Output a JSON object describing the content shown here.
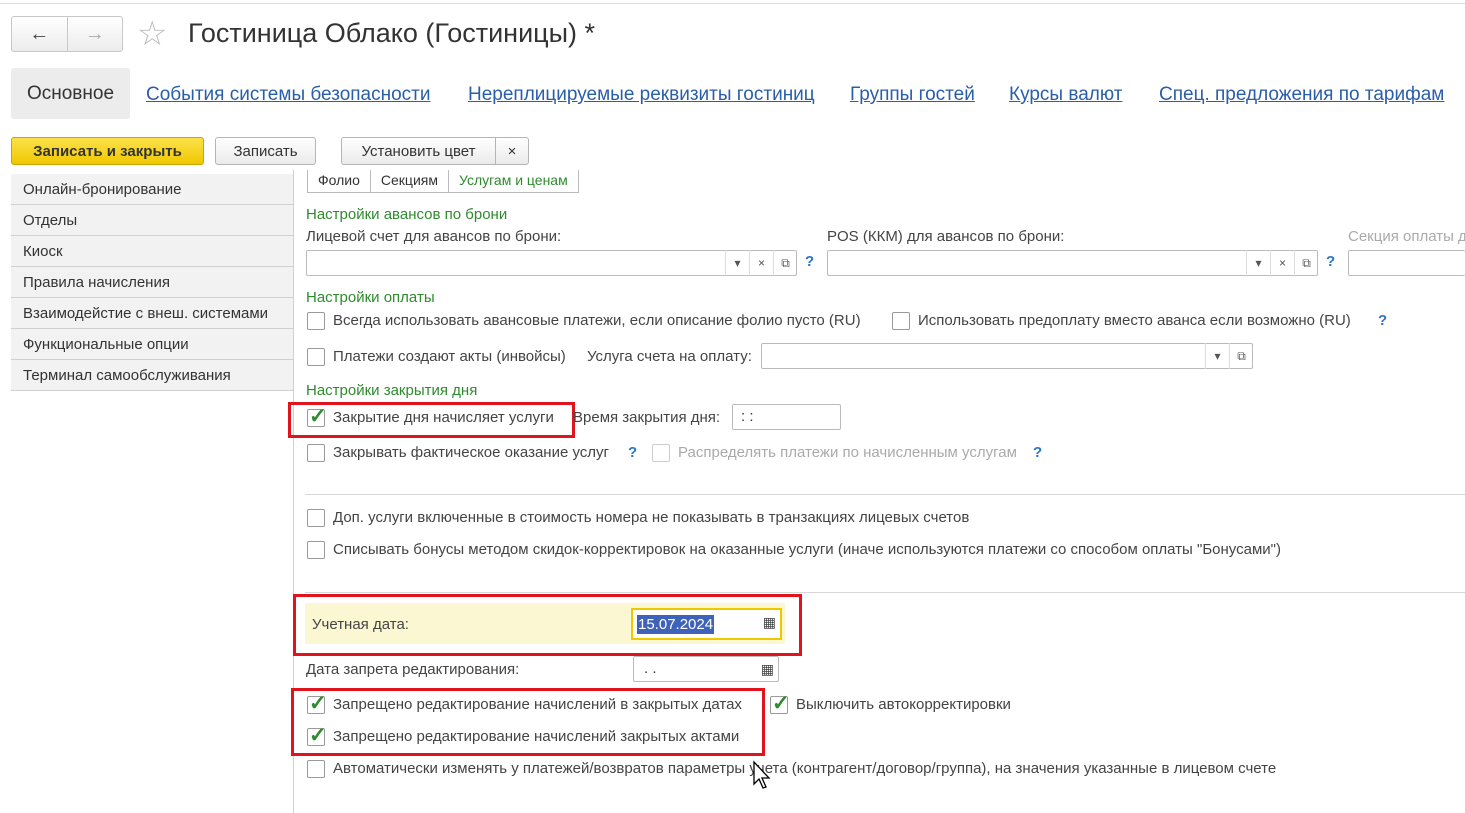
{
  "window": {
    "title": "Гостиница Облако (Гостиницы) *",
    "back_icon": "←",
    "forward_icon": "→",
    "star_icon": "☆"
  },
  "tabs": {
    "active": "Основное",
    "links": [
      "События системы безопасности",
      "Нереплицируемые реквизиты гостиниц",
      "Группы гостей",
      "Курсы валют",
      "Спец. предложения по тарифам"
    ]
  },
  "toolbar": {
    "save_close": "Записать и закрыть",
    "save": "Записать",
    "set_color": "Установить цвет",
    "clear": "×"
  },
  "sidebar": {
    "items": [
      "Онлайн-бронирование",
      "Отделы",
      "Киоск",
      "Правила начисления",
      "Взаимодейстие с внеш. системами",
      "Функциональные опции",
      "Терминал самообслуживания"
    ]
  },
  "inner_tabs": [
    "Фолио",
    "Секциям",
    "Услугам и ценам"
  ],
  "advances": {
    "section": "Настройки авансов по брони",
    "folio_label": "Лицевой счет для авансов по брони:",
    "pos_label": "POS (ККМ) для авансов по брони:",
    "section_label": "Секция оплаты д"
  },
  "payment": {
    "section": "Настройки оплаты",
    "always_advance": "Всегда использовать авансовые платежи, если описание фолио пусто (RU)",
    "use_prepay": "Использовать предоплату вместо аванса если возможно (RU)",
    "payments_acts": "Платежи создают акты (инвойсы)",
    "service_label": "Услуга счета на оплату:"
  },
  "closing": {
    "section": "Настройки закрытия дня",
    "closing_charges": "Закрытие дня начисляет услуги",
    "close_time_label": "Время закрытия дня:",
    "close_time_value": " :  :",
    "close_actual": "Закрывать фактическое оказание услуг",
    "distribute": "Распределять платежи по начисленным услугам"
  },
  "misc": {
    "extra_services": "Доп. услуги включенные в стоимость номера не показывать в транзакциях лицевых счетов",
    "bonuses": "Списывать бонусы методом скидок-корректировок на оказанные услуги (иначе используются платежи со способом оплаты \"Бонусами\")"
  },
  "dates": {
    "accounting_label": "Учетная дата:",
    "accounting_value": "15.07.2024",
    "lock_label": "Дата запрета редактирования:",
    "lock_value": " .  .",
    "calendar_icon": "▦"
  },
  "restrictions": {
    "closed_dates": "Запрещено редактирование начислений в закрытых датах",
    "auto_corr": "Выключить автокорректировки",
    "closed_acts": "Запрещено редактирование начислений закрытых актами",
    "auto_change": "Автоматически изменять у платежей/возвратов параметры учета (контрагент/договор/группа), на значения указанные в лицевом счете"
  },
  "glyphs": {
    "dropdown": "▾",
    "clear": "×",
    "open": "⧉",
    "help": "?",
    "check": "✓"
  }
}
